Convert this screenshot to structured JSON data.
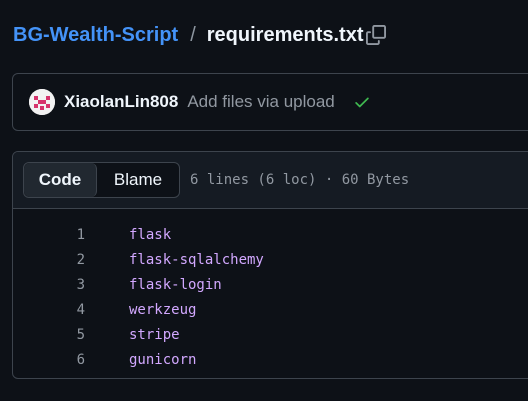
{
  "breadcrumb": {
    "repo": "BG-Wealth-Script",
    "separator": "/",
    "file": "requirements.txt",
    "copy_icon": "copy-icon"
  },
  "commit": {
    "author": "XiaolanLin808",
    "message": "Add files via upload",
    "status_icon": "check-icon",
    "status_color": "#3fb950"
  },
  "file_view": {
    "tabs": [
      {
        "label": "Code",
        "active": true
      },
      {
        "label": "Blame",
        "active": false
      }
    ],
    "info": "6 lines (6 loc) · 60 Bytes",
    "lines": [
      {
        "n": "1",
        "text": "flask"
      },
      {
        "n": "2",
        "text": "flask-sqlalchemy"
      },
      {
        "n": "3",
        "text": "flask-login"
      },
      {
        "n": "4",
        "text": "werkzeug"
      },
      {
        "n": "5",
        "text": "stripe"
      },
      {
        "n": "6",
        "text": "gunicorn"
      }
    ]
  },
  "colors": {
    "background": "#0d1117",
    "link": "#4493f8",
    "code_text": "#d2a8ff",
    "avatar_accent": "#d6336c"
  }
}
